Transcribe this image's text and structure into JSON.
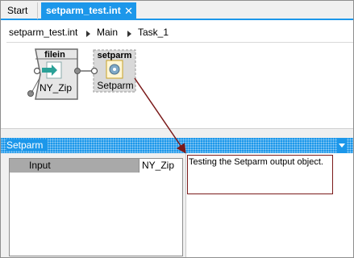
{
  "tabs": [
    {
      "label": "Start",
      "active": false
    },
    {
      "label": "setparm_test.int",
      "active": true,
      "close_glyph": "✕"
    }
  ],
  "breadcrumb": [
    "setparm_test.int",
    "Main",
    "Task_1"
  ],
  "canvas": {
    "nodes": [
      {
        "title": "filein",
        "label": "NY_Zip",
        "icon": "arrow-in-icon"
      },
      {
        "title": "setparm",
        "label": "Setparm",
        "icon": "gear-icon"
      }
    ]
  },
  "panel": {
    "title": "Setparm",
    "grid": [
      {
        "label": "Input",
        "value": "NY_Zip"
      }
    ],
    "description": "Testing the Setparm output object."
  },
  "colors": {
    "accent": "#1c97ea",
    "callout": "#7b1a1a",
    "grid_label_bg": "#a9a9a9"
  }
}
